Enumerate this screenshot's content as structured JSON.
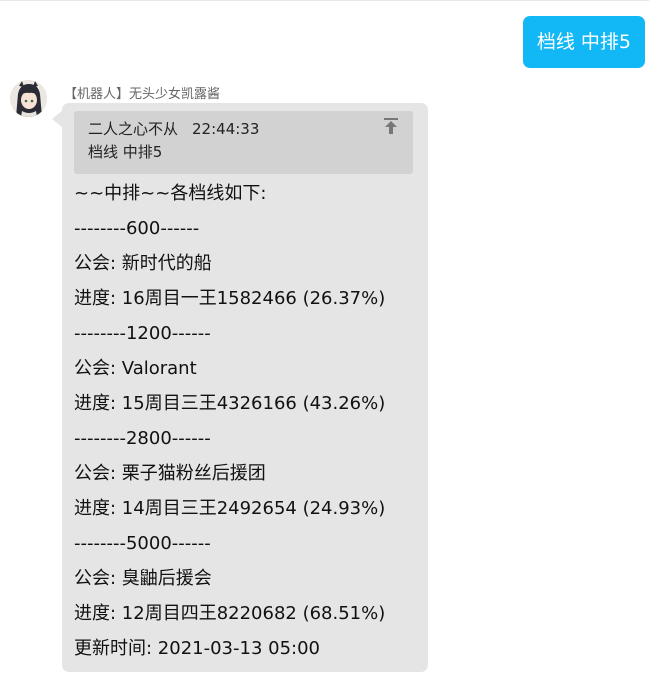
{
  "outgoing": {
    "text": "档线 中排5"
  },
  "incoming": {
    "sender": "【机器人】无头少女凯露酱",
    "avatar_icon": "anime-girl-avatar",
    "reply": {
      "sender": "二人之心不从",
      "time": "22:44:33",
      "text": "档线 中排5",
      "jump_icon": "jump-to-top-icon"
    },
    "lines": [
      "~~中排~~各档线如下:",
      "--------600------",
      "公会: 新时代的船",
      "进度: 16周目一王1582466 (26.37%)",
      "--------1200------",
      "公会: Valorant",
      "进度: 15周目三王4326166 (43.26%)",
      "--------2800------",
      "公会: 栗子猫粉丝后援团",
      "进度: 14周目三王2492654 (24.93%)",
      "--------5000------",
      "公会: 臭鼬后援会",
      "进度: 12周目四王8220682 (68.51%)",
      "更新时间: 2021-03-13 05:00"
    ]
  },
  "colors": {
    "outgoing_bubble": "#12b7f5",
    "incoming_bubble": "#e5e5e5",
    "reply_box": "#d2d2d2",
    "sender_name": "#666666"
  }
}
